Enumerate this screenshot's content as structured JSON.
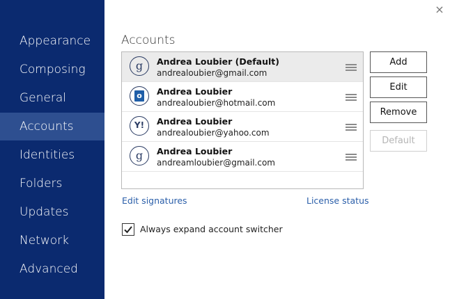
{
  "sidebar": {
    "items": [
      {
        "label": "Appearance",
        "active": false
      },
      {
        "label": "Composing",
        "active": false
      },
      {
        "label": "General",
        "active": false
      },
      {
        "label": "Accounts",
        "active": true
      },
      {
        "label": "Identities",
        "active": false
      },
      {
        "label": "Folders",
        "active": false
      },
      {
        "label": "Updates",
        "active": false
      },
      {
        "label": "Network",
        "active": false
      },
      {
        "label": "Advanced",
        "active": false
      }
    ]
  },
  "window": {
    "close_glyph": "×"
  },
  "main": {
    "title": "Accounts",
    "accounts": [
      {
        "name": "Andrea Loubier (Default)",
        "email": "andrealoubier@gmail.com",
        "icon": "gmail-icon",
        "icon_glyph": "g",
        "selected": true
      },
      {
        "name": "Andrea Loubier",
        "email": "andrealoubier@hotmail.com",
        "icon": "outlook-icon",
        "icon_glyph": "o",
        "selected": false
      },
      {
        "name": "Andrea Loubier",
        "email": "andrealoubier@yahoo.com",
        "icon": "yahoo-icon",
        "icon_glyph": "Y!",
        "selected": false
      },
      {
        "name": "Andrea Loubier",
        "email": "andreamloubier@gmail.com",
        "icon": "gmail-icon",
        "icon_glyph": "g",
        "selected": false
      }
    ],
    "buttons": {
      "add": "Add",
      "edit": "Edit",
      "remove": "Remove",
      "default": "Default"
    },
    "links": {
      "edit_signatures": "Edit signatures",
      "license_status": "License status"
    },
    "checkbox": {
      "label": "Always expand account switcher",
      "checked": true
    }
  },
  "colors": {
    "sidebar_bg": "#0b2a6f",
    "sidebar_active": "#2e4f90",
    "link": "#2a5ea9"
  }
}
